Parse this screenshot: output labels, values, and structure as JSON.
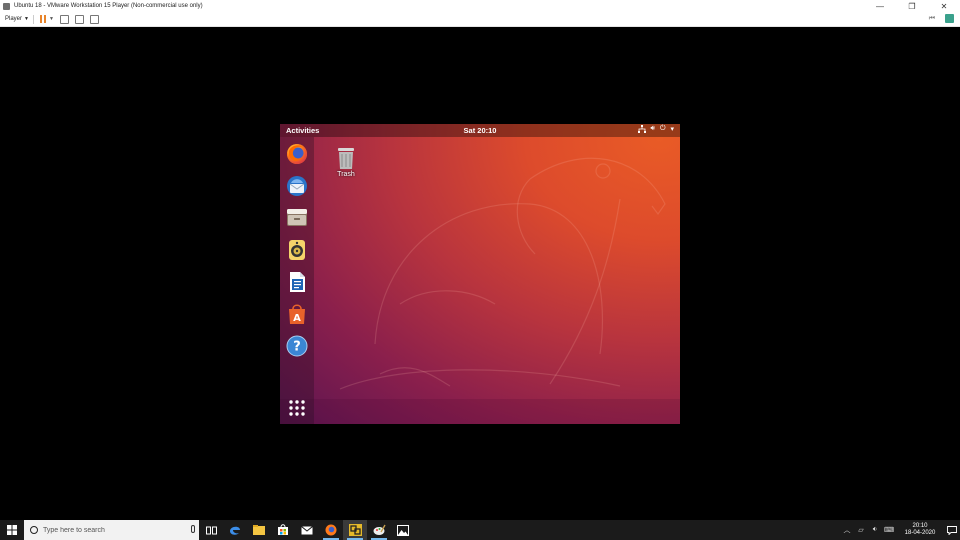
{
  "window": {
    "title": "Ubuntu 18 - VMware Workstation 15 Player (Non-commercial use only)",
    "controls": [
      "minimize",
      "restore",
      "close"
    ]
  },
  "toolbar": {
    "player_label": "Player",
    "icons": [
      "pause-icon",
      "send-ctrl-alt-del-icon",
      "fullscreen-icon",
      "unity-icon"
    ],
    "right_icons": [
      "back-icon",
      "notes-icon"
    ]
  },
  "ubuntu": {
    "topbar": {
      "activities": "Activities",
      "clock": "Sat 20:10",
      "status_icons": [
        "network-icon",
        "volume-icon",
        "power-icon",
        "menu-caret-icon"
      ]
    },
    "dock": [
      {
        "name": "firefox-icon"
      },
      {
        "name": "thunderbird-icon"
      },
      {
        "name": "files-icon"
      },
      {
        "name": "rhythmbox-icon"
      },
      {
        "name": "libreoffice-writer-icon"
      },
      {
        "name": "ubuntu-software-icon"
      },
      {
        "name": "help-icon"
      }
    ],
    "show_apps_icon": "show-applications-icon",
    "desktop": {
      "trash_label": "Trash"
    },
    "colors": {
      "wallpaper_orange": "#e95b26",
      "wallpaper_purple": "#5c1551"
    }
  },
  "taskbar": {
    "search_placeholder": "Type here to search",
    "apps": [
      "task-view-icon",
      "edge-icon",
      "file-explorer-icon",
      "store-icon",
      "mail-icon",
      "firefox-icon",
      "vmware-icon",
      "paint-icon",
      "photos-icon"
    ],
    "active_app": "vmware-icon",
    "clock_time": "20:10",
    "clock_date": "18-04-2020",
    "tray_icons": [
      "chevron-up-icon",
      "network-icon",
      "volume-icon",
      "keyboard-icon",
      "notifications-icon"
    ]
  }
}
